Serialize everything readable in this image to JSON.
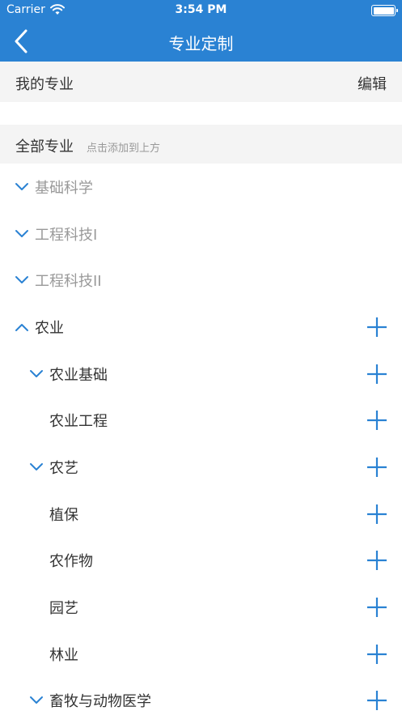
{
  "status_bar": {
    "carrier": "Carrier",
    "time": "3:54 PM"
  },
  "nav": {
    "title": "专业定制",
    "back_icon": "chevron-left-icon"
  },
  "my_majors": {
    "title": "我的专业",
    "edit_label": "编辑"
  },
  "all_majors": {
    "title": "全部专业",
    "hint": "点击添加到上方"
  },
  "colors": {
    "brand": "#2a82d3",
    "section_bg": "#f4f4f4",
    "dim_text": "#999999",
    "text": "#333333"
  },
  "tree": [
    {
      "label": "基础科学",
      "level": 0,
      "chevron": "down",
      "dim": true,
      "add": false
    },
    {
      "label": "工程科技I",
      "level": 0,
      "chevron": "down",
      "dim": true,
      "add": false
    },
    {
      "label": "工程科技II",
      "level": 0,
      "chevron": "down",
      "dim": true,
      "add": false
    },
    {
      "label": "农业",
      "level": 0,
      "chevron": "up",
      "dim": false,
      "add": true
    },
    {
      "label": "农业基础",
      "level": 1,
      "chevron": "down",
      "dim": false,
      "add": true
    },
    {
      "label": "农业工程",
      "level": 1,
      "chevron": "none",
      "dim": false,
      "add": true
    },
    {
      "label": "农艺",
      "level": 1,
      "chevron": "down",
      "dim": false,
      "add": true
    },
    {
      "label": "植保",
      "level": 1,
      "chevron": "none",
      "dim": false,
      "add": true
    },
    {
      "label": "农作物",
      "level": 1,
      "chevron": "none",
      "dim": false,
      "add": true
    },
    {
      "label": "园艺",
      "level": 1,
      "chevron": "none",
      "dim": false,
      "add": true
    },
    {
      "label": "林业",
      "level": 1,
      "chevron": "none",
      "dim": false,
      "add": true
    },
    {
      "label": "畜牧与动物医学",
      "level": 1,
      "chevron": "down",
      "dim": false,
      "add": true
    }
  ]
}
